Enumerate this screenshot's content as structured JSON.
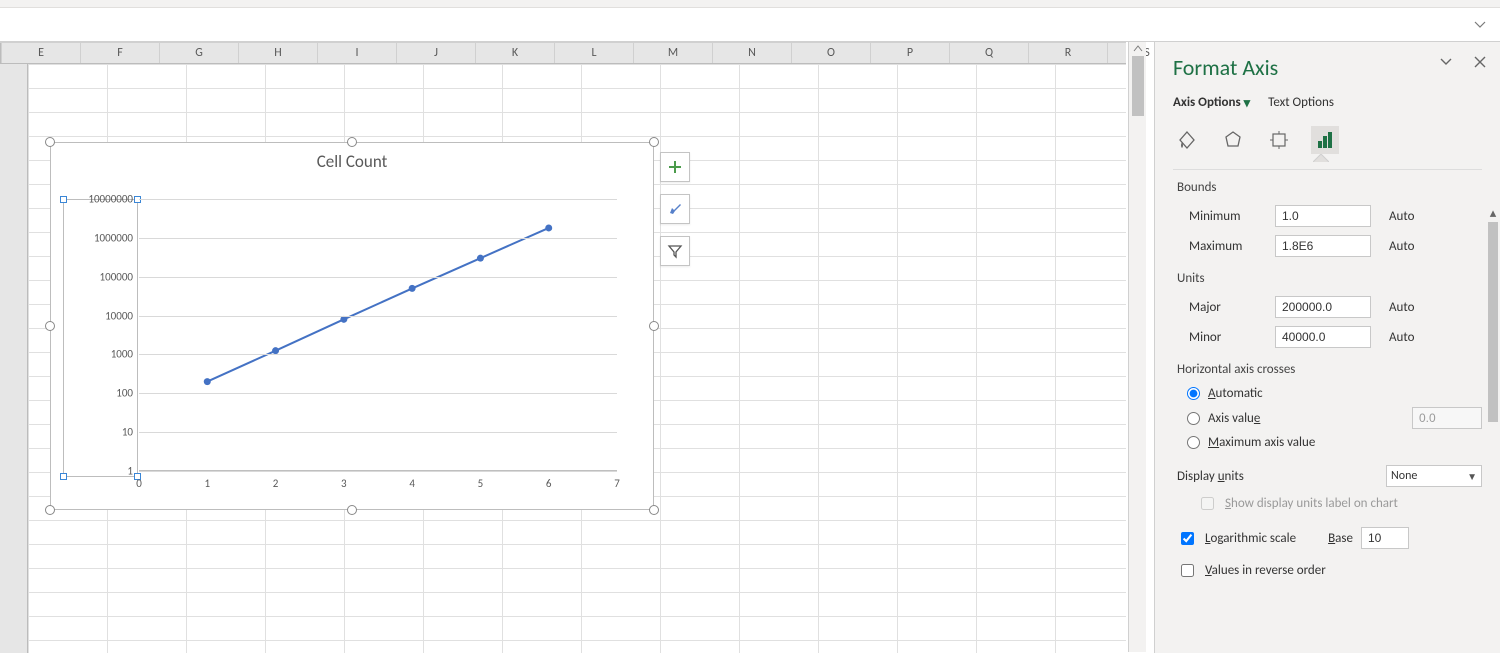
{
  "columns": [
    "E",
    "F",
    "G",
    "H",
    "I",
    "J",
    "K",
    "L",
    "M",
    "N",
    "O",
    "P",
    "Q",
    "R",
    "S"
  ],
  "chart_data": {
    "type": "line",
    "title": "Cell Count",
    "xlabel": "",
    "ylabel": "",
    "x": [
      1,
      2,
      3,
      4,
      5,
      6
    ],
    "values": [
      200,
      1250,
      8000,
      50000,
      300000,
      1800000
    ],
    "xticks": [
      0,
      1,
      2,
      3,
      4,
      5,
      6,
      7
    ],
    "yticks": [
      1,
      10,
      100,
      1000,
      10000,
      100000,
      1000000,
      10000000
    ],
    "ytick_labels": [
      "1",
      "10",
      "100",
      "1000",
      "10000",
      "100000",
      "1000000",
      "10000000"
    ],
    "xlim": [
      0,
      7
    ],
    "ylim": [
      1,
      10000000
    ],
    "yscale": "log"
  },
  "chart_buttons": {
    "add": "+",
    "style": "brush",
    "filter": "funnel"
  },
  "pane": {
    "title": "Format Axis",
    "tabs": {
      "axis_options": "Axis Options",
      "text_options": "Text Options"
    },
    "icons": {
      "fill": "fill-line-icon",
      "effects": "effects-icon",
      "size": "size-properties-icon",
      "axis": "axis-options-icon"
    },
    "sections": {
      "bounds": {
        "head": "Bounds",
        "minimum_label": "Minimum",
        "minimum_value": "1.0",
        "minimum_mode": "Auto",
        "maximum_label": "Maximum",
        "maximum_value": "1.8E6",
        "maximum_mode": "Auto"
      },
      "units": {
        "head": "Units",
        "major_label": "Major",
        "major_value": "200000.0",
        "major_mode": "Auto",
        "minor_label": "Minor",
        "minor_value": "40000.0",
        "minor_mode": "Auto"
      },
      "crosses": {
        "head": "Horizontal axis crosses",
        "automatic": "Automatic",
        "axis_value": "Axis value",
        "axis_value_num": "0.0",
        "max_axis_value": "Maximum axis value"
      },
      "display_units": {
        "label": "Display units",
        "value": "None",
        "show_label_checkbox": "Show display units label on chart"
      },
      "log": {
        "log_scale": "Logarithmic scale",
        "base_label": "Base",
        "base_value": "10"
      },
      "reverse": {
        "label": "Values in reverse order"
      }
    }
  }
}
